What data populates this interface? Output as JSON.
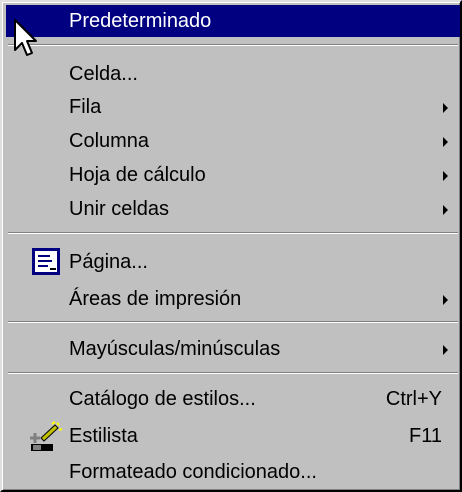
{
  "menu": {
    "items": [
      {
        "label": "Predeterminado"
      },
      {
        "label": "Celda..."
      },
      {
        "label": "Fila"
      },
      {
        "label": "Columna"
      },
      {
        "label": "Hoja de cálculo"
      },
      {
        "label": "Unir celdas"
      },
      {
        "label": "Página..."
      },
      {
        "label": "Áreas de impresión"
      },
      {
        "label": "Mayúsculas/minúsculas"
      },
      {
        "label": "Catálogo de estilos...",
        "shortcut": "Ctrl+Y"
      },
      {
        "label": "Estilista",
        "shortcut": "F11"
      },
      {
        "label": "Formateado condicionado..."
      }
    ]
  },
  "icons": {
    "cursor": "mouse-pointer-icon",
    "page": "page-setup-icon",
    "stylist": "stylist-icon",
    "submenu": "submenu-arrow-icon"
  },
  "colors": {
    "menu_background": "#c0c0c0",
    "highlight": "#000080",
    "highlight_text": "#ffffff"
  }
}
